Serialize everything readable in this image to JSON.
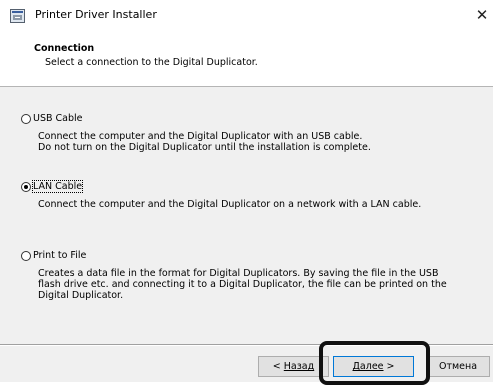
{
  "window": {
    "title": "Printer Driver Installer",
    "close_symbol": "✕"
  },
  "header": {
    "title": "Connection",
    "subtitle": "Select a connection to the Digital Duplicator."
  },
  "options": [
    {
      "label": "USB Cable",
      "checked": false,
      "description": [
        "Connect the computer and the Digital Duplicator with an USB cable.",
        "Do not turn on the Digital Duplicator until the installation is complete."
      ]
    },
    {
      "label": "LAN Cable",
      "checked": true,
      "description": [
        "Connect the computer and the Digital Duplicator on a network with a LAN cable."
      ]
    },
    {
      "label": "Print to File",
      "checked": false,
      "description": [
        "Creates a data file in the format for Digital Duplicators. By saving the file in the USB flash drive etc. and connecting it to a Digital Duplicator, the file can be printed on the Digital Duplicator."
      ]
    }
  ],
  "buttons": {
    "back_prefix": "< ",
    "back_label": "Назад",
    "next_label": "Далее",
    "next_suffix": " >",
    "cancel_label": "Отмена"
  },
  "icons": {
    "app_icon": "printer-installer-icon",
    "close_icon": "close-icon"
  },
  "colors": {
    "default_button_border": "#0078d7",
    "highlight_border": "#111111"
  }
}
